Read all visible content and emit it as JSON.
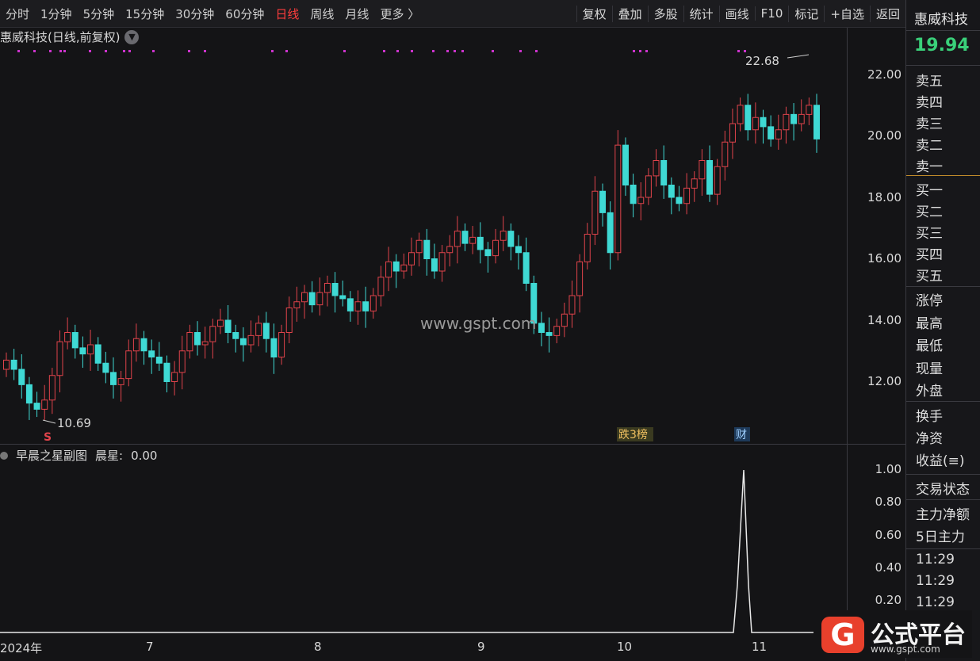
{
  "toolbar": {
    "periods": [
      "分时",
      "1分钟",
      "5分钟",
      "15分钟",
      "30分钟",
      "60分钟",
      "日线",
      "周线",
      "月线",
      "更多 〉"
    ],
    "active_period": "日线",
    "right_buttons": [
      "复权",
      "叠加",
      "多股",
      "统计",
      "画线",
      "F10",
      "标记",
      "+自选",
      "返回"
    ]
  },
  "main_chart": {
    "title": "惠威科技(日线,前复权)",
    "price_labels": [
      "22.00",
      "20.00",
      "18.00",
      "16.00",
      "14.00",
      "12.00"
    ],
    "high_marker": "22.68",
    "low_marker": "10.69",
    "tags": {
      "dragon": "跌3榜",
      "finance": "财",
      "s_mark": "S"
    },
    "center_watermark": "www.gspt.com"
  },
  "sub_chart": {
    "title": "早晨之星副图",
    "indicator_name": "晨星:",
    "indicator_value": "0.00",
    "axis_labels": [
      "1.00",
      "0.80",
      "0.60",
      "0.40",
      "0.20"
    ]
  },
  "xaxis": {
    "labels": [
      "2024年",
      "7",
      "8",
      "9",
      "10",
      "11"
    ]
  },
  "right_panel": {
    "stock_name": "惠威科技",
    "price": "19.94",
    "price_color": "#3ad17a",
    "sell": [
      "卖五",
      "卖四",
      "卖三",
      "卖二",
      "卖一"
    ],
    "buy": [
      "买一",
      "买二",
      "买三",
      "买四",
      "买五"
    ],
    "stats": [
      "涨停",
      "最高",
      "最低",
      "现量",
      "外盘"
    ],
    "stats2": [
      "换手",
      "净资",
      "收益(≡)"
    ],
    "extra": [
      "交易状态",
      "主力净额",
      "5日主力"
    ],
    "times": [
      "11:29",
      "11:29",
      "11:29"
    ]
  },
  "logo": {
    "text": "公式平台",
    "url": "www.gspt.com",
    "icon": "G"
  },
  "colors": {
    "up": "#e0434b",
    "down": "#3fd9d4",
    "marker": "#cc33cc",
    "background": "#141416"
  }
}
